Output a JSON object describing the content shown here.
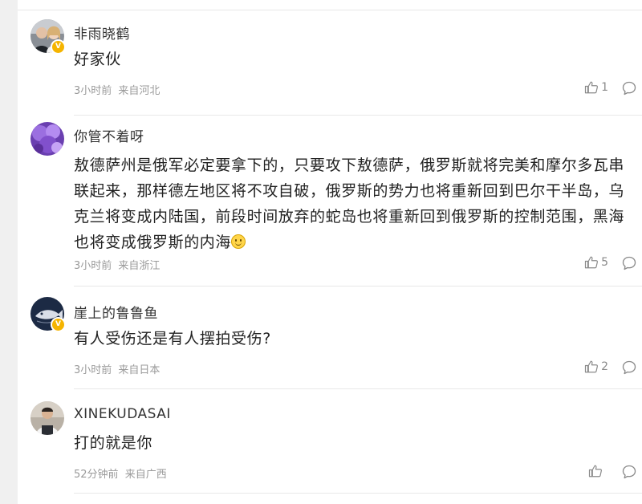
{
  "comments": [
    {
      "username": "非雨晓鹤",
      "text": "好家伙",
      "time": "3小时前",
      "location": "来自河北",
      "likes": "1",
      "verified": true
    },
    {
      "username": "你管不着呀",
      "text": "敖德萨州是俄军必定要拿下的，只要攻下敖德萨，俄罗斯就将完美和摩尔多瓦串联起来，那样德左地区将不攻自破，俄罗斯的势力也将重新回到巴尔干半岛，乌克兰将变成内陆国，前段时间放弃的蛇岛也将重新回到俄罗斯的控制范围，黑海也将变成俄罗斯的内海",
      "time": "3小时前",
      "location": "来自浙江",
      "likes": "5",
      "verified": false
    },
    {
      "username": "崖上的鲁鲁鱼",
      "text": "有人受伤还是有人摆拍受伤?",
      "time": "3小时前",
      "location": "来自日本",
      "likes": "2",
      "verified": true
    },
    {
      "username": "XINEKUDASAI",
      "text": "打的就是你",
      "time": "52分钟前",
      "location": "来自广西",
      "likes": "",
      "verified": false
    }
  ],
  "icons": {
    "like": "thumb-up-icon",
    "reply": "comment-bubble-icon",
    "verified": "v-badge-icon"
  },
  "colors": {
    "badge": "#f5b400",
    "meta_text": "#9a9a9a",
    "body_text": "#222222"
  }
}
